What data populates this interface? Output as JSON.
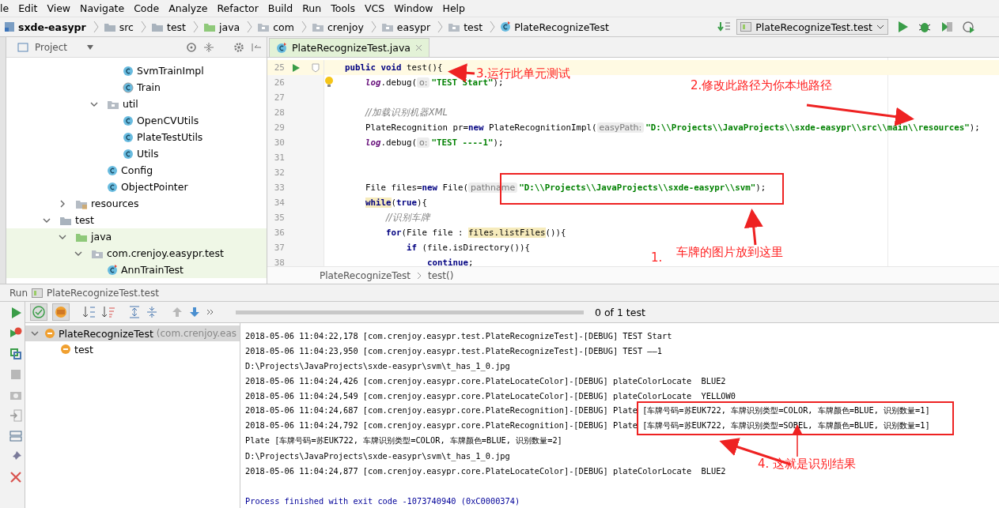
{
  "menu": [
    "le",
    "Edit",
    "View",
    "Navigate",
    "Code",
    "Analyze",
    "Refactor",
    "Build",
    "Run",
    "Tools",
    "VCS",
    "Window",
    "Help"
  ],
  "breadcrumbs": [
    {
      "label": "sxde-easypr",
      "kind": "project"
    },
    {
      "label": "src",
      "kind": "folder"
    },
    {
      "label": "test",
      "kind": "folder"
    },
    {
      "label": "java",
      "kind": "source-folder"
    },
    {
      "label": "com",
      "kind": "package"
    },
    {
      "label": "crenjoy",
      "kind": "package"
    },
    {
      "label": "easypr",
      "kind": "package"
    },
    {
      "label": "test",
      "kind": "package"
    },
    {
      "label": "PlateRecognizeTest",
      "kind": "test-class"
    }
  ],
  "run_config": "PlateRecognizeTest.test",
  "project_panel": {
    "title": "Project",
    "tree": [
      {
        "children": [
          {
            "children": [
              {
                "children": [
                  {
                    "children": [
                      {
                        "label": "SvmTrainImpl",
                        "kind": "class"
                      },
                      {
                        "label": "Train",
                        "kind": "abstract-class"
                      }
                    ]
                  },
                  {
                    "label": "util",
                    "kind": "package",
                    "expanded": true,
                    "children": [
                      {
                        "label": "OpenCVUtils",
                        "kind": "class"
                      },
                      {
                        "label": "PlateTestUtils",
                        "kind": "class"
                      },
                      {
                        "label": "Utils",
                        "kind": "class"
                      }
                    ]
                  },
                  {
                    "label": "Config",
                    "kind": "class"
                  },
                  {
                    "label": "ObjectPointer",
                    "kind": "class"
                  }
                ]
              }
            ]
          },
          {
            "label": "resources",
            "kind": "resources-folder",
            "expanded": false
          }
        ]
      },
      {
        "label": "test",
        "kind": "folder",
        "expanded": true,
        "children": [
          {
            "label": "java",
            "kind": "source-folder",
            "expanded": true,
            "tinted": true,
            "children": [
              {
                "label": "com.crenjoy.easypr.test",
                "kind": "package",
                "expanded": true,
                "tinted": true,
                "children": [
                  {
                    "label": "AnnTrainTest",
                    "kind": "test-class",
                    "tinted": true
                  }
                ]
              }
            ]
          }
        ]
      }
    ]
  },
  "editor": {
    "tabs": [
      {
        "label": "PlateRecognizeTest.java",
        "selected": true
      }
    ],
    "lines": [
      {
        "n": "25",
        "current": true,
        "run_button": true,
        "tokens": [
          {
            "kind": "kw",
            "text": "public void"
          },
          {
            "kind": "plain",
            "text": " test(){"
          }
        ],
        "children": [
          {
            "n": "26",
            "intention_bulb": true,
            "tokens": [
              {
                "kind": "field",
                "text": "log"
              },
              {
                "kind": "plain",
                "text": ".debug("
              },
              {
                "kind": "hint",
                "text": "o:"
              },
              {
                "kind": "str",
                "text": "\"TEST Start\""
              },
              {
                "kind": "plain",
                "text": ");"
              }
            ]
          },
          {
            "n": "27"
          },
          {
            "n": "28",
            "tokens": [
              {
                "kind": "comment",
                "text": "//加载识别机器XML"
              }
            ]
          },
          {
            "n": "29",
            "tokens": [
              {
                "kind": "plain",
                "text": "PlateRecognition pr="
              },
              {
                "kind": "kw",
                "text": "new"
              },
              {
                "kind": "plain",
                "text": " PlateRecognitionImpl("
              },
              {
                "kind": "hint",
                "text": "easyPath:"
              },
              {
                "kind": "str",
                "text": "\"D:\\\\Projects\\\\JavaProjects\\\\sxde-easypr\\\\src\\\\main\\\\resources\""
              },
              {
                "kind": "plain",
                "text": ");"
              }
            ]
          },
          {
            "n": "30",
            "tokens": [
              {
                "kind": "field",
                "text": "log"
              },
              {
                "kind": "plain",
                "text": ".debug("
              },
              {
                "kind": "hint",
                "text": "o:"
              },
              {
                "kind": "str",
                "text": "\"TEST ----1\""
              },
              {
                "kind": "plain",
                "text": ");"
              }
            ]
          },
          {
            "n": "31"
          },
          {
            "n": "32"
          },
          {
            "n": "33",
            "tokens": [
              {
                "kind": "plain",
                "text": "File files="
              },
              {
                "kind": "kw",
                "text": "new"
              },
              {
                "kind": "plain",
                "text": " File("
              },
              {
                "kind": "hint",
                "text": "pathname"
              },
              {
                "kind": "str",
                "text": "\"D:\\\\Projects\\\\JavaProjects\\\\sxde-easypr\\\\svm\""
              },
              {
                "kind": "plain",
                "text": ");"
              }
            ]
          },
          {
            "n": "34",
            "tokens": [
              {
                "kind": "kw-mark",
                "text": "while"
              },
              {
                "kind": "plain",
                "text": "("
              },
              {
                "kind": "kw",
                "text": "true"
              },
              {
                "kind": "plain",
                "text": "){"
              }
            ],
            "children": [
              {
                "n": "35",
                "tokens": [
                  {
                    "kind": "comment",
                    "text": "//识别车牌"
                  }
                ]
              },
              {
                "n": "36",
                "tokens": [
                  {
                    "kind": "kw",
                    "text": "for"
                  },
                  {
                    "kind": "plain",
                    "text": "(File file : "
                  },
                  {
                    "kind": "mark",
                    "text": "files.listFiles"
                  },
                  {
                    "kind": "plain",
                    "text": "()){"
                  }
                ],
                "children": [
                  {
                    "n": "37",
                    "tokens": [
                      {
                        "kind": "kw",
                        "text": "if"
                      },
                      {
                        "kind": "plain",
                        "text": " (file.isDirectory()){"
                      }
                    ],
                    "children": [
                      {
                        "n": "38",
                        "tokens": [
                          {
                            "kind": "kw",
                            "text": "continue"
                          },
                          {
                            "kind": "plain",
                            "text": ";"
                          }
                        ]
                      }
                    ]
                  }
                ]
              }
            ]
          }
        ]
      }
    ],
    "breadcrumb": [
      "PlateRecognizeTest",
      "test()"
    ]
  },
  "run_panel": {
    "title": "Run",
    "config": "PlateRecognizeTest.test",
    "summary": "0 of 1 test",
    "tree": [
      {
        "label": "PlateRecognizeTest",
        "detail": "(com.crenjoy.eas",
        "selected": true,
        "expanded": true,
        "children": [
          {
            "label": "test",
            "selected": false
          }
        ]
      }
    ],
    "console": [
      {
        "kind": "log",
        "text": "2018-05-06 11:04:22,178 [com.crenjoy.easypr.test.PlateRecognizeTest]-[DEBUG] TEST Start"
      },
      {
        "kind": "log",
        "text": "2018-05-06 11:04:23,950 [com.crenjoy.easypr.test.PlateRecognizeTest]-[DEBUG] TEST ——1"
      },
      {
        "kind": "log",
        "text": "D:\\Projects\\JavaProjects\\sxde-easypr\\svm\\t_has_1_0.jpg"
      },
      {
        "kind": "log",
        "text": "2018-05-06 11:04:24,426 [com.crenjoy.easypr.core.PlateLocateColor]-[DEBUG] plateColorLocate  BLUE2"
      },
      {
        "kind": "log",
        "text": "2018-05-06 11:04:24,549 [com.crenjoy.easypr.core.PlateLocateColor]-[DEBUG] plateColorLocate  YELLOW0"
      },
      {
        "kind": "log",
        "text": "2018-05-06 11:04:24,687 [com.crenjoy.easypr.core.PlateRecognition]-[DEBUG] Plate [车牌号码=苏EUK722, 车牌识别类型=COLOR, 车牌颜色=BLUE, 识别数量=1]"
      },
      {
        "kind": "log",
        "text": "2018-05-06 11:04:24,792 [com.crenjoy.easypr.core.PlateRecognition]-[DEBUG] Plate [车牌号码=苏EUK722, 车牌识别类型=SOBEL, 车牌颜色=BLUE, 识别数量=1]"
      },
      {
        "kind": "log",
        "text": "Plate [车牌号码=苏EUK722, 车牌识别类型=COLOR, 车牌颜色=BLUE, 识别数量=2]"
      },
      {
        "kind": "log",
        "text": "D:\\Projects\\JavaProjects\\sxde-easypr\\svm\\t_has_1_0.jpg"
      },
      {
        "kind": "log",
        "text": "2018-05-06 11:04:24,877 [com.crenjoy.easypr.core.PlateLocateColor]-[DEBUG] plateColorLocate  BLUE2"
      },
      {
        "kind": "blank"
      },
      {
        "kind": "exit",
        "text": "Process finished with exit code -1073740940 (0xC0000374)"
      }
    ]
  },
  "annotations": [
    {
      "text": "3.运行此单元测试"
    },
    {
      "text": "2.修改此路径为你本地路径"
    },
    {
      "text": "1."
    },
    {
      "text": "车牌的图片放到这里"
    },
    {
      "text": "4.  这就是识别结果"
    }
  ]
}
